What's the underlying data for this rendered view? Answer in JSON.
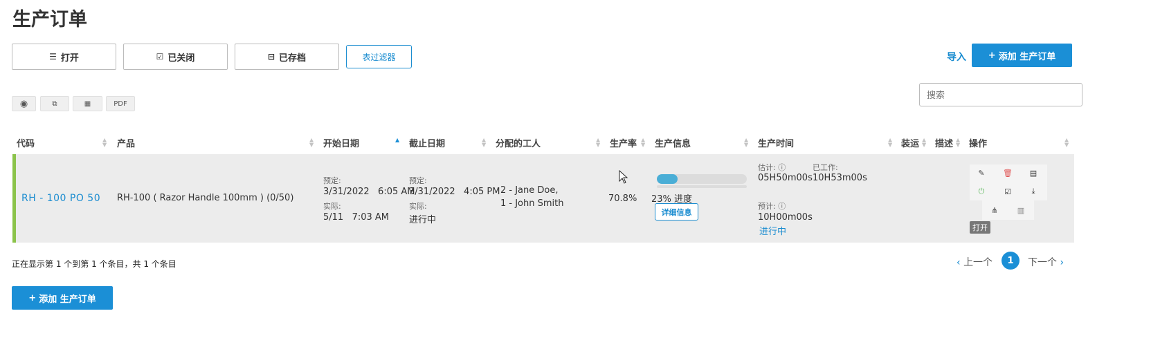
{
  "page": {
    "title": "生产订单"
  },
  "filters": {
    "open": {
      "label": "打开",
      "icon": "list-icon"
    },
    "closed": {
      "label": "已关闭",
      "icon": "check-square-icon"
    },
    "archived": {
      "label": "已存档",
      "icon": "inbox-icon"
    },
    "table_filter": "表过滤器"
  },
  "actions": {
    "import": "导入",
    "add_label": "添加 生产订单"
  },
  "tools": {
    "view": "eye-icon",
    "copy": "copy-icon",
    "grid": "table-icon",
    "pdf": "PDF"
  },
  "search": {
    "placeholder": "搜索"
  },
  "table": {
    "columns": [
      "代码",
      "产品",
      "开始日期",
      "截止日期",
      "分配的工人",
      "生产率",
      "生产信息",
      "生产时间",
      "装运",
      "描述",
      "操作"
    ],
    "row": {
      "code": "RH - 100 PO 50",
      "product": "RH-100 ( Razor Handle 100mm ) (0/50)",
      "start_planned_label": "预定:",
      "start_planned": "3/31/2022   6:05 AM",
      "start_actual_label": "实际:",
      "start_actual": "5/11   7:03 AM",
      "due_planned_label": "预定:",
      "due_planned": "3/31/2022   4:05 PM",
      "due_actual_label": "实际:",
      "due_actual": "进行中",
      "workers_line1": "2 - Jane Doe,",
      "workers_line2": "1 - John Smith",
      "rate": "70.8%",
      "progress_percent": 23,
      "progress_text": "23% 进度",
      "details_button": "详细信息",
      "est_label": "估计:",
      "est_value": "05H50m00s",
      "worked_label": "已工作:",
      "worked_value": "10H53m00s",
      "forecast_label": "预计:",
      "forecast_value": "10H00m00s",
      "time_status": "进行中",
      "tooltip": "打开"
    }
  },
  "footer": {
    "summary": "正在显示第 1 个到第 1 个条目，共 1 个条目",
    "prev": "上一个",
    "current_page": "1",
    "next": "下一个"
  },
  "colors": {
    "accent": "#1b8fd6",
    "status_bar": "#8bc34a",
    "delete": "#e05555",
    "power": "#5cb85c"
  }
}
